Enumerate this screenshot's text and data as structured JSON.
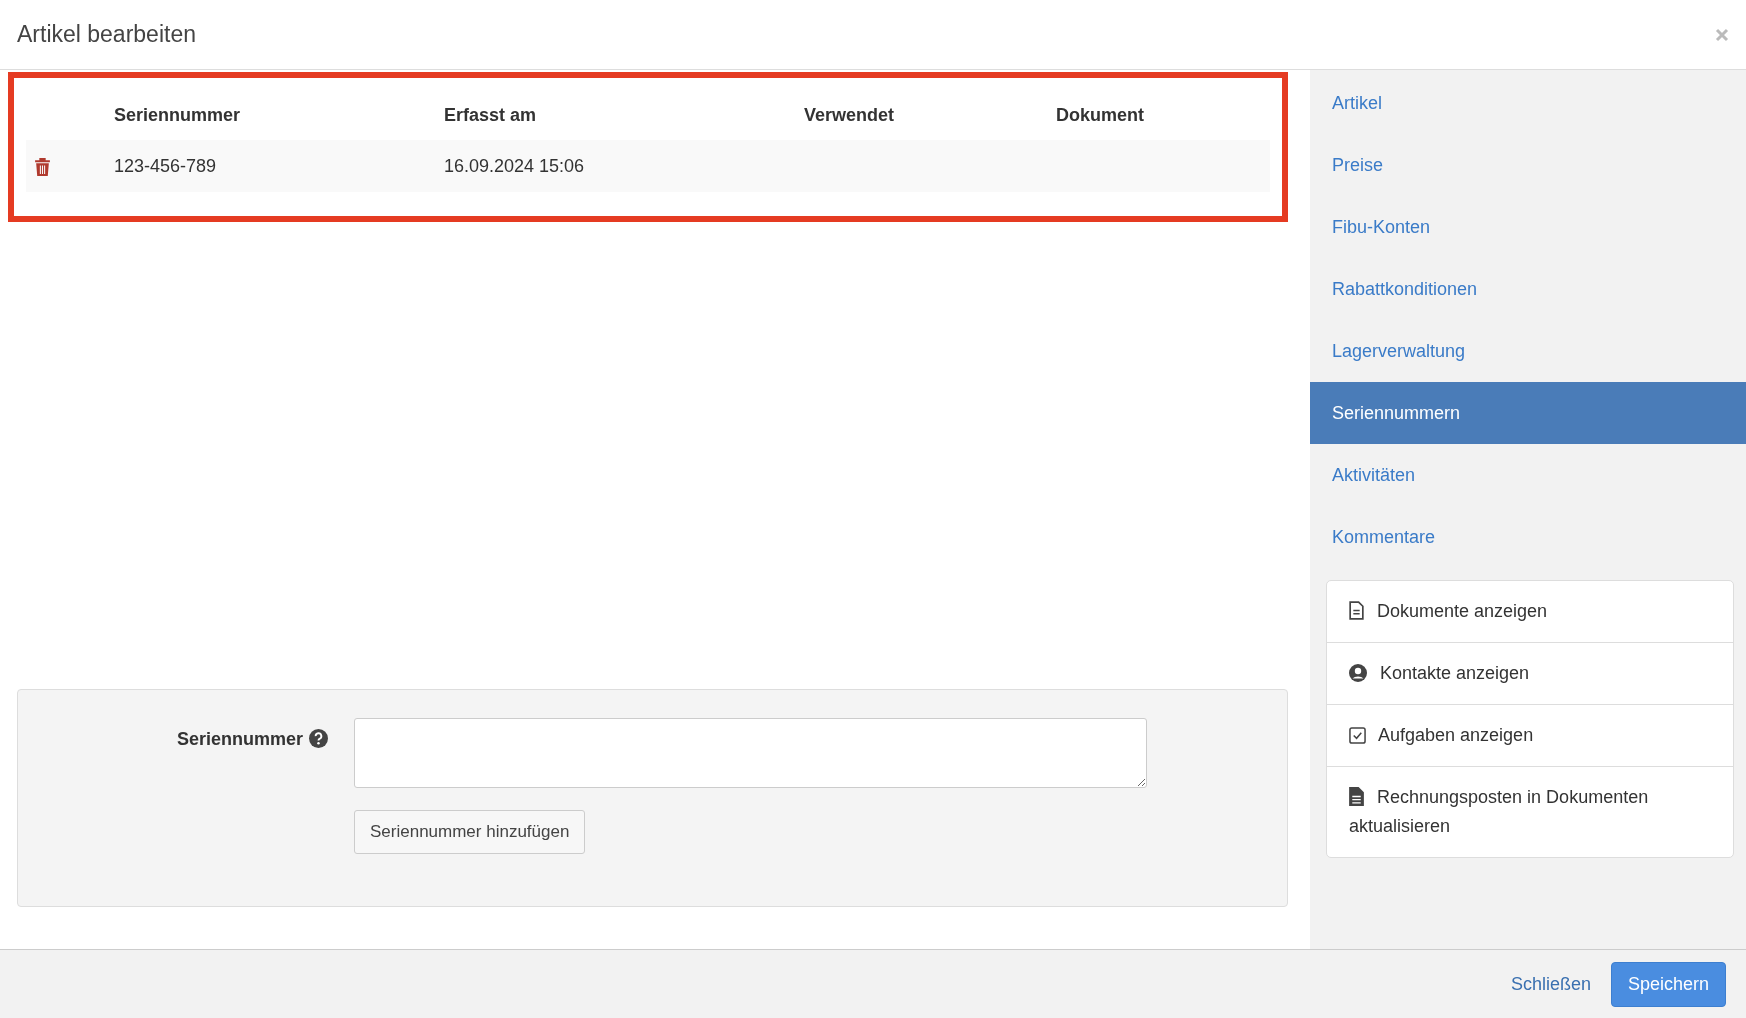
{
  "window": {
    "title": "Artikel bearbeiten"
  },
  "table": {
    "columns": [
      "Seriennummer",
      "Erfasst am",
      "Verwendet",
      "Dokument"
    ],
    "rows": [
      {
        "cells": [
          "123-456-789",
          "16.09.2024 15:06",
          "",
          ""
        ]
      }
    ]
  },
  "form": {
    "label": "Seriennummer",
    "button": "Seriennummer hinzufügen"
  },
  "sidebar": {
    "items": [
      {
        "label": "Artikel",
        "selected": false
      },
      {
        "label": "Preise",
        "selected": false
      },
      {
        "label": "Fibu-Konten",
        "selected": false
      },
      {
        "label": "Rabattkonditionen",
        "selected": false
      },
      {
        "label": "Lagerverwaltung",
        "selected": false
      },
      {
        "label": "Seriennummern",
        "selected": true
      },
      {
        "label": "Aktivitäten",
        "selected": false
      },
      {
        "label": "Kommentare",
        "selected": false
      }
    ],
    "actions": [
      {
        "kind": "document",
        "label": "Dokumente anzeigen"
      },
      {
        "kind": "contact",
        "label": "Kontakte anzeigen"
      },
      {
        "kind": "task",
        "label": "Aufgaben anzeigen"
      },
      {
        "kind": "filled-document",
        "label": "Rechnungsposten in Dokumenten aktualisieren"
      }
    ]
  },
  "footer": {
    "buttons": [
      {
        "kind": "link",
        "label": "Schließen"
      },
      {
        "kind": "primary",
        "label": "Speichern"
      }
    ]
  }
}
